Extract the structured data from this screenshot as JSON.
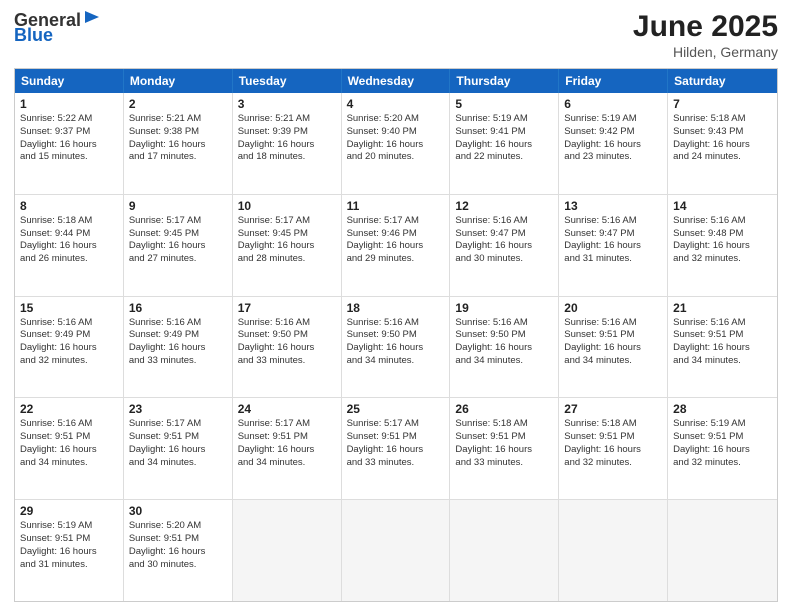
{
  "header": {
    "logo_general": "General",
    "logo_blue": "Blue",
    "month": "June 2025",
    "location": "Hilden, Germany"
  },
  "days": [
    "Sunday",
    "Monday",
    "Tuesday",
    "Wednesday",
    "Thursday",
    "Friday",
    "Saturday"
  ],
  "rows": [
    [
      {
        "num": "1",
        "info": "Sunrise: 5:22 AM\nSunset: 9:37 PM\nDaylight: 16 hours\nand 15 minutes."
      },
      {
        "num": "2",
        "info": "Sunrise: 5:21 AM\nSunset: 9:38 PM\nDaylight: 16 hours\nand 17 minutes."
      },
      {
        "num": "3",
        "info": "Sunrise: 5:21 AM\nSunset: 9:39 PM\nDaylight: 16 hours\nand 18 minutes."
      },
      {
        "num": "4",
        "info": "Sunrise: 5:20 AM\nSunset: 9:40 PM\nDaylight: 16 hours\nand 20 minutes."
      },
      {
        "num": "5",
        "info": "Sunrise: 5:19 AM\nSunset: 9:41 PM\nDaylight: 16 hours\nand 22 minutes."
      },
      {
        "num": "6",
        "info": "Sunrise: 5:19 AM\nSunset: 9:42 PM\nDaylight: 16 hours\nand 23 minutes."
      },
      {
        "num": "7",
        "info": "Sunrise: 5:18 AM\nSunset: 9:43 PM\nDaylight: 16 hours\nand 24 minutes."
      }
    ],
    [
      {
        "num": "8",
        "info": "Sunrise: 5:18 AM\nSunset: 9:44 PM\nDaylight: 16 hours\nand 26 minutes."
      },
      {
        "num": "9",
        "info": "Sunrise: 5:17 AM\nSunset: 9:45 PM\nDaylight: 16 hours\nand 27 minutes."
      },
      {
        "num": "10",
        "info": "Sunrise: 5:17 AM\nSunset: 9:45 PM\nDaylight: 16 hours\nand 28 minutes."
      },
      {
        "num": "11",
        "info": "Sunrise: 5:17 AM\nSunset: 9:46 PM\nDaylight: 16 hours\nand 29 minutes."
      },
      {
        "num": "12",
        "info": "Sunrise: 5:16 AM\nSunset: 9:47 PM\nDaylight: 16 hours\nand 30 minutes."
      },
      {
        "num": "13",
        "info": "Sunrise: 5:16 AM\nSunset: 9:47 PM\nDaylight: 16 hours\nand 31 minutes."
      },
      {
        "num": "14",
        "info": "Sunrise: 5:16 AM\nSunset: 9:48 PM\nDaylight: 16 hours\nand 32 minutes."
      }
    ],
    [
      {
        "num": "15",
        "info": "Sunrise: 5:16 AM\nSunset: 9:49 PM\nDaylight: 16 hours\nand 32 minutes."
      },
      {
        "num": "16",
        "info": "Sunrise: 5:16 AM\nSunset: 9:49 PM\nDaylight: 16 hours\nand 33 minutes."
      },
      {
        "num": "17",
        "info": "Sunrise: 5:16 AM\nSunset: 9:50 PM\nDaylight: 16 hours\nand 33 minutes."
      },
      {
        "num": "18",
        "info": "Sunrise: 5:16 AM\nSunset: 9:50 PM\nDaylight: 16 hours\nand 34 minutes."
      },
      {
        "num": "19",
        "info": "Sunrise: 5:16 AM\nSunset: 9:50 PM\nDaylight: 16 hours\nand 34 minutes."
      },
      {
        "num": "20",
        "info": "Sunrise: 5:16 AM\nSunset: 9:51 PM\nDaylight: 16 hours\nand 34 minutes."
      },
      {
        "num": "21",
        "info": "Sunrise: 5:16 AM\nSunset: 9:51 PM\nDaylight: 16 hours\nand 34 minutes."
      }
    ],
    [
      {
        "num": "22",
        "info": "Sunrise: 5:16 AM\nSunset: 9:51 PM\nDaylight: 16 hours\nand 34 minutes."
      },
      {
        "num": "23",
        "info": "Sunrise: 5:17 AM\nSunset: 9:51 PM\nDaylight: 16 hours\nand 34 minutes."
      },
      {
        "num": "24",
        "info": "Sunrise: 5:17 AM\nSunset: 9:51 PM\nDaylight: 16 hours\nand 34 minutes."
      },
      {
        "num": "25",
        "info": "Sunrise: 5:17 AM\nSunset: 9:51 PM\nDaylight: 16 hours\nand 33 minutes."
      },
      {
        "num": "26",
        "info": "Sunrise: 5:18 AM\nSunset: 9:51 PM\nDaylight: 16 hours\nand 33 minutes."
      },
      {
        "num": "27",
        "info": "Sunrise: 5:18 AM\nSunset: 9:51 PM\nDaylight: 16 hours\nand 32 minutes."
      },
      {
        "num": "28",
        "info": "Sunrise: 5:19 AM\nSunset: 9:51 PM\nDaylight: 16 hours\nand 32 minutes."
      }
    ],
    [
      {
        "num": "29",
        "info": "Sunrise: 5:19 AM\nSunset: 9:51 PM\nDaylight: 16 hours\nand 31 minutes."
      },
      {
        "num": "30",
        "info": "Sunrise: 5:20 AM\nSunset: 9:51 PM\nDaylight: 16 hours\nand 30 minutes."
      },
      {
        "num": "",
        "info": ""
      },
      {
        "num": "",
        "info": ""
      },
      {
        "num": "",
        "info": ""
      },
      {
        "num": "",
        "info": ""
      },
      {
        "num": "",
        "info": ""
      }
    ]
  ]
}
